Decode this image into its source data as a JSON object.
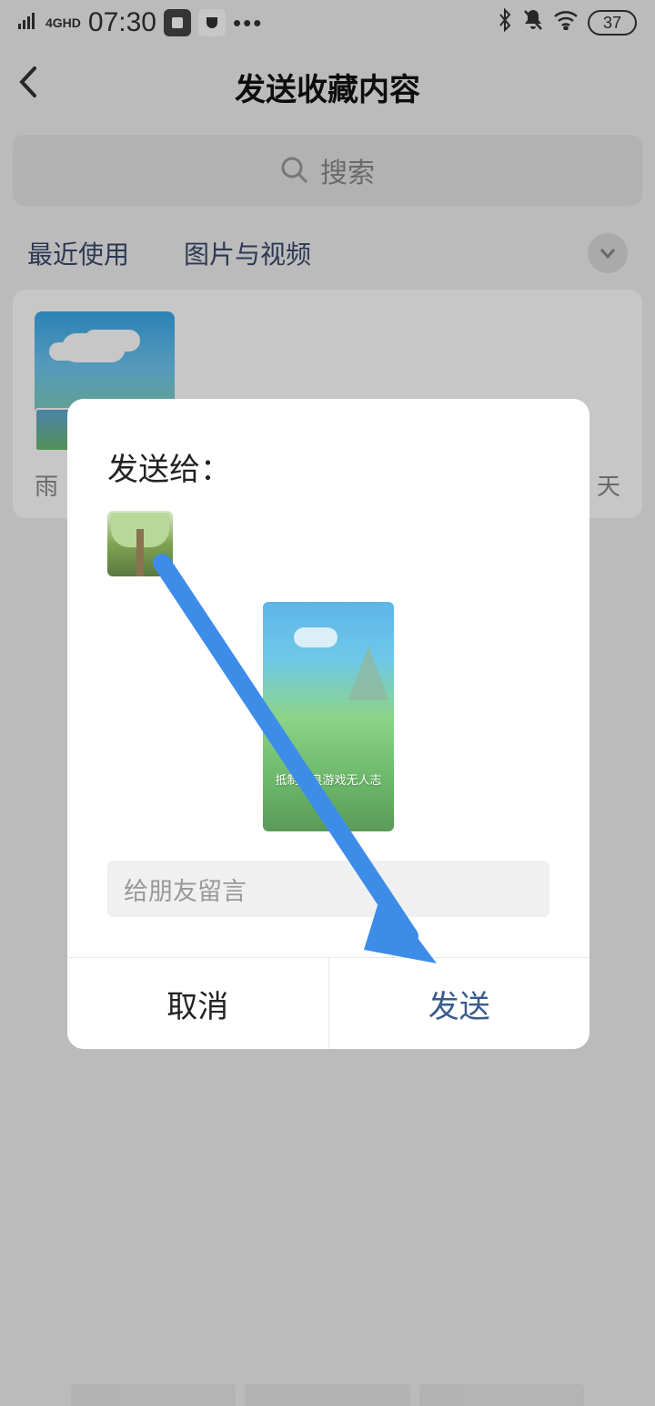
{
  "statusbar": {
    "network": "4GHD",
    "time": "07:30",
    "battery": "37"
  },
  "header": {
    "title": "发送收藏内容"
  },
  "search": {
    "placeholder": "搜索"
  },
  "tabs": {
    "recent": "最近使用",
    "media": "图片与视频"
  },
  "card": {
    "label_prefix": "雨",
    "date_suffix": "天"
  },
  "modal": {
    "send_to_label": "发送给：",
    "input_placeholder": "给朋友留言",
    "cancel": "取消",
    "send": "发送"
  }
}
